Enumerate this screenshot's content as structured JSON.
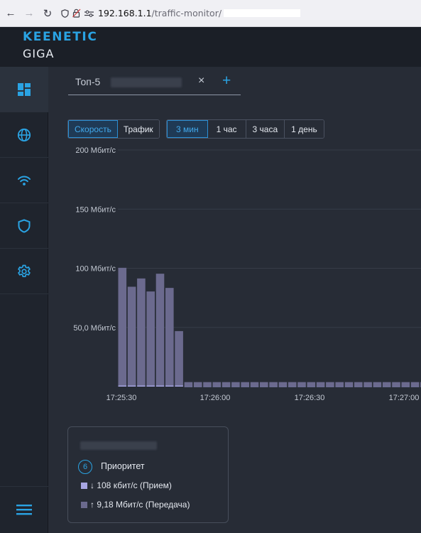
{
  "browser": {
    "url_host": "192.168.1.1",
    "url_path": "/traffic-monitor/"
  },
  "brand": {
    "line1": "KEENETIC",
    "line2": "GIGA",
    "accent_color": "#2aa3e3"
  },
  "sidebar": {
    "items": [
      {
        "icon": "dashboard-icon",
        "active": true
      },
      {
        "icon": "globe-icon",
        "active": false
      },
      {
        "icon": "wifi-icon",
        "active": false
      },
      {
        "icon": "shield-icon",
        "active": false
      },
      {
        "icon": "gear-icon",
        "active": false
      }
    ],
    "menu_icon": "hamburger-menu-icon"
  },
  "tabs": {
    "items": [
      {
        "label": "Топ-5"
      }
    ],
    "close_symbol": "×",
    "add_symbol": "+"
  },
  "mode_buttons": [
    {
      "label": "Скорость",
      "active": true
    },
    {
      "label": "Трафик",
      "active": false
    }
  ],
  "range_buttons": [
    {
      "label": "3 мин",
      "active": true
    },
    {
      "label": "1 час",
      "active": false
    },
    {
      "label": "3 часа",
      "active": false
    },
    {
      "label": "1 день",
      "active": false
    }
  ],
  "chart_data": {
    "type": "bar",
    "stacked": true,
    "yticks": [
      "50,0 Мбит/с",
      "100 Мбит/с",
      "150 Мбит/с",
      "200 Мбит/с"
    ],
    "ytick_values": [
      50,
      100,
      150,
      200
    ],
    "ylim": [
      0,
      200
    ],
    "y_unit": "Мбит/с",
    "xticks": [
      "17:25:30",
      "17:26:00",
      "17:26:30",
      "17:27:00"
    ],
    "grid": true,
    "series": [
      {
        "name": "Прием",
        "color": "#a7a6e3",
        "values": [
          0.9,
          0.9,
          0.9,
          0.9,
          0.9,
          0.9,
          0.9,
          0.2,
          0.2,
          0.2,
          0.2,
          0.2,
          0.2,
          0.2,
          0.2,
          0.2,
          0.2,
          0.2,
          0.2,
          0.2,
          0.2,
          0.2,
          0.2,
          0.2,
          0.2,
          0.2,
          0.2,
          0.2,
          0.2,
          0.2,
          0.2,
          0.2,
          0.2
        ]
      },
      {
        "name": "Передача",
        "color": "#6b6a8e",
        "values": [
          99.5,
          83.5,
          90.5,
          79.5,
          94.5,
          82.5,
          46,
          3.6,
          3.6,
          3.6,
          3.6,
          3.6,
          3.6,
          3.6,
          3.6,
          3.6,
          3.6,
          3.6,
          3.6,
          3.6,
          3.6,
          3.6,
          3.6,
          3.6,
          3.6,
          3.6,
          3.6,
          3.6,
          3.6,
          3.6,
          3.6,
          3.6,
          3.6
        ]
      }
    ]
  },
  "legend": {
    "priority_number": "6",
    "priority_label": "Приоритет",
    "rx_text": "↓ 108 кбит/с (Прием)",
    "tx_text": "↑ 9,18 Мбит/с (Передача)",
    "rx_color": "#a7a6e3",
    "tx_color": "#6b6a8e"
  }
}
